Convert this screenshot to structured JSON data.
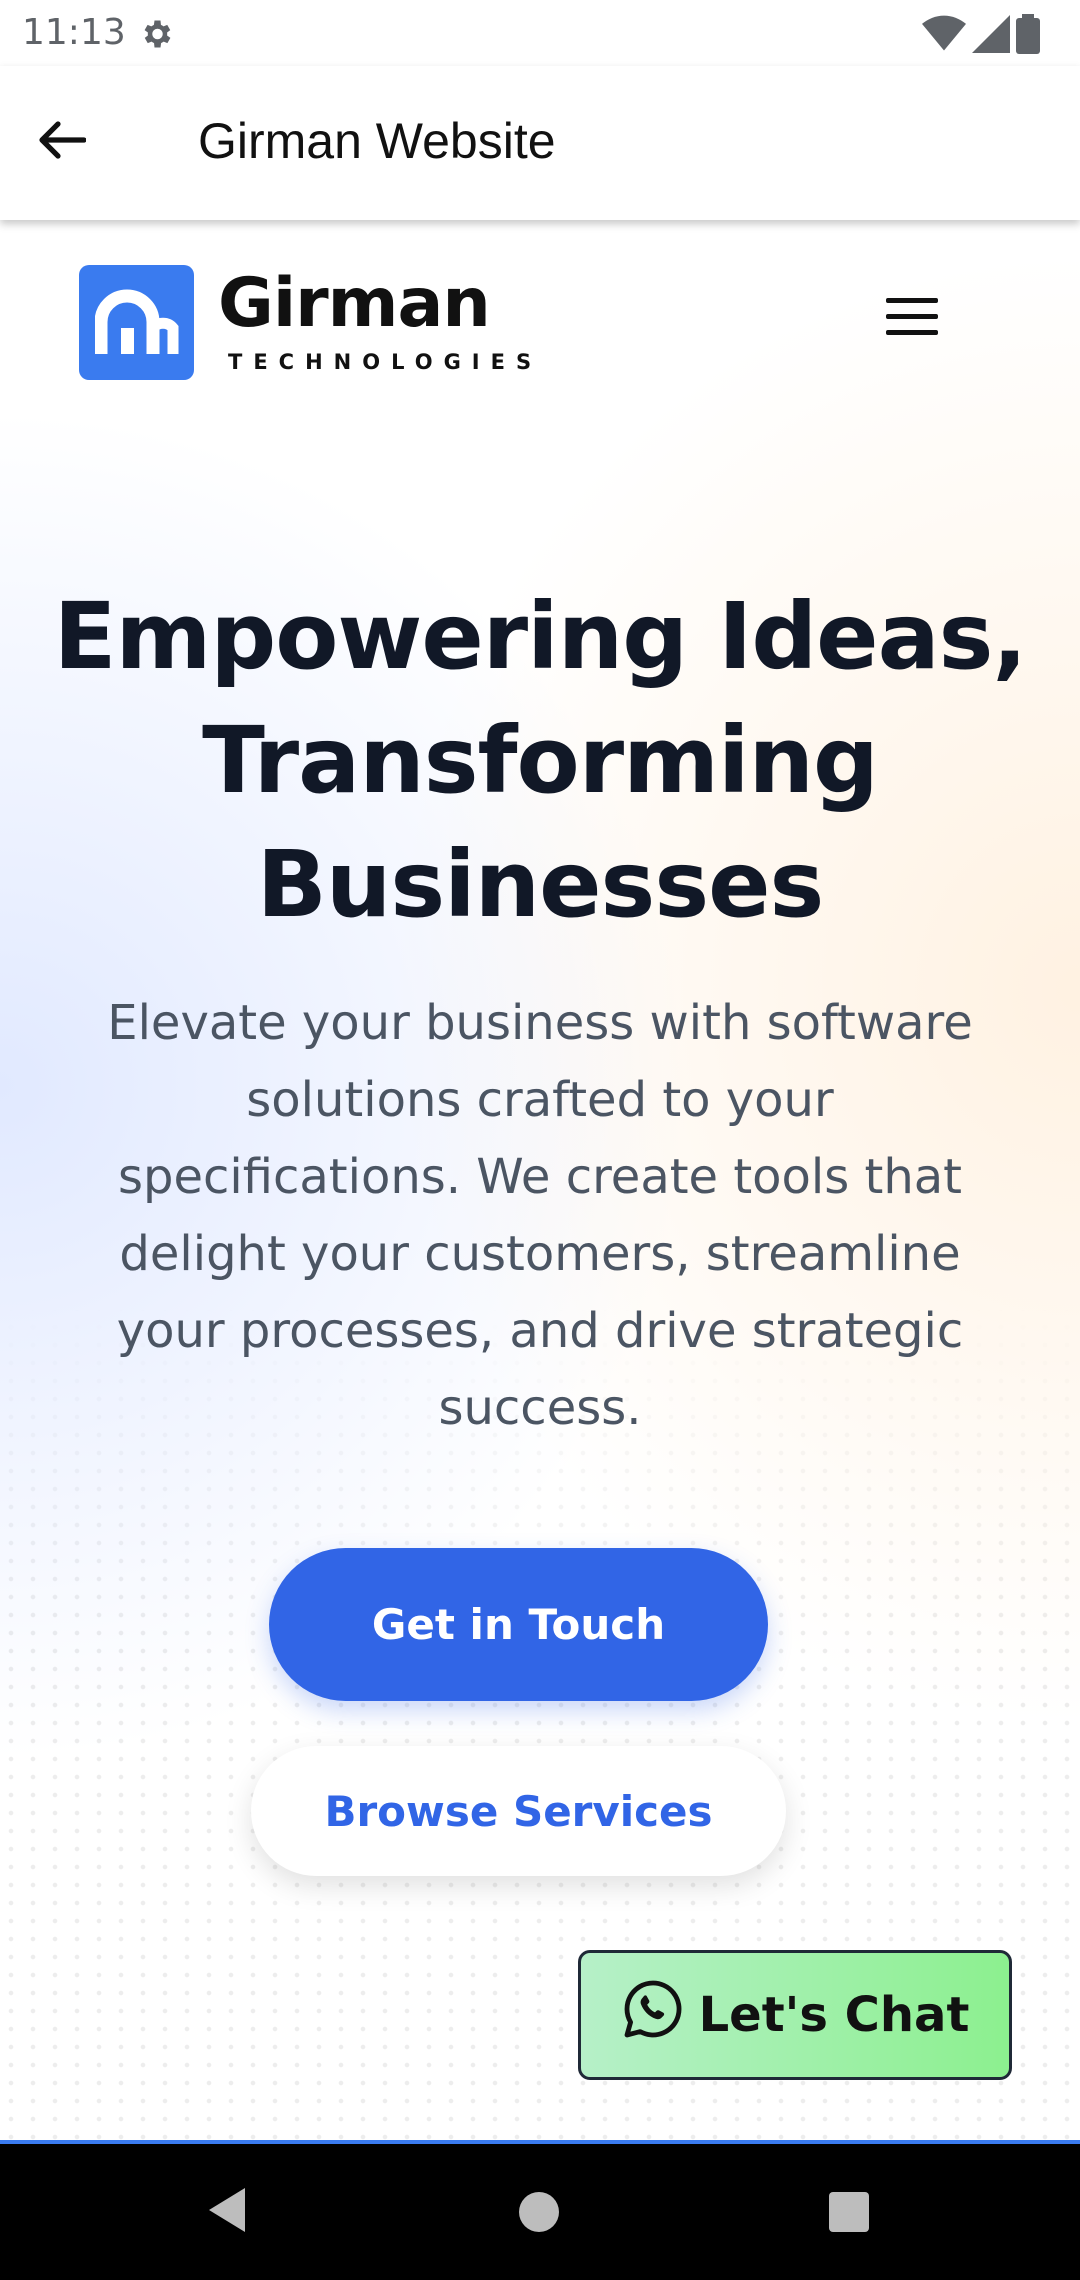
{
  "status_bar": {
    "time": "11:13",
    "icons": [
      "gear-icon",
      "wifi-icon",
      "signal-icon",
      "battery-icon"
    ]
  },
  "app_bar": {
    "title": "Girman Website",
    "back_icon": "arrow-left-icon"
  },
  "site_header": {
    "logo_name": "Girman",
    "logo_tagline": "TECHNOLOGIES",
    "menu_icon": "hamburger-menu-icon"
  },
  "hero": {
    "title_line1": "Empowering Ideas,",
    "title_line2": "Transforming",
    "title_line3": "Businesses",
    "subtitle": "Elevate your business with software solutions crafted to your specifications. We create tools that delight your customers, streamline your processes, and drive strategic success.",
    "primary_button": "Get in Touch",
    "secondary_button": "Browse Services"
  },
  "chat": {
    "label": "Let's Chat",
    "icon": "whatsapp-icon"
  },
  "colors": {
    "accent": "#3165e6",
    "chat_green": "#8cf08f",
    "text_dark": "#111827"
  }
}
